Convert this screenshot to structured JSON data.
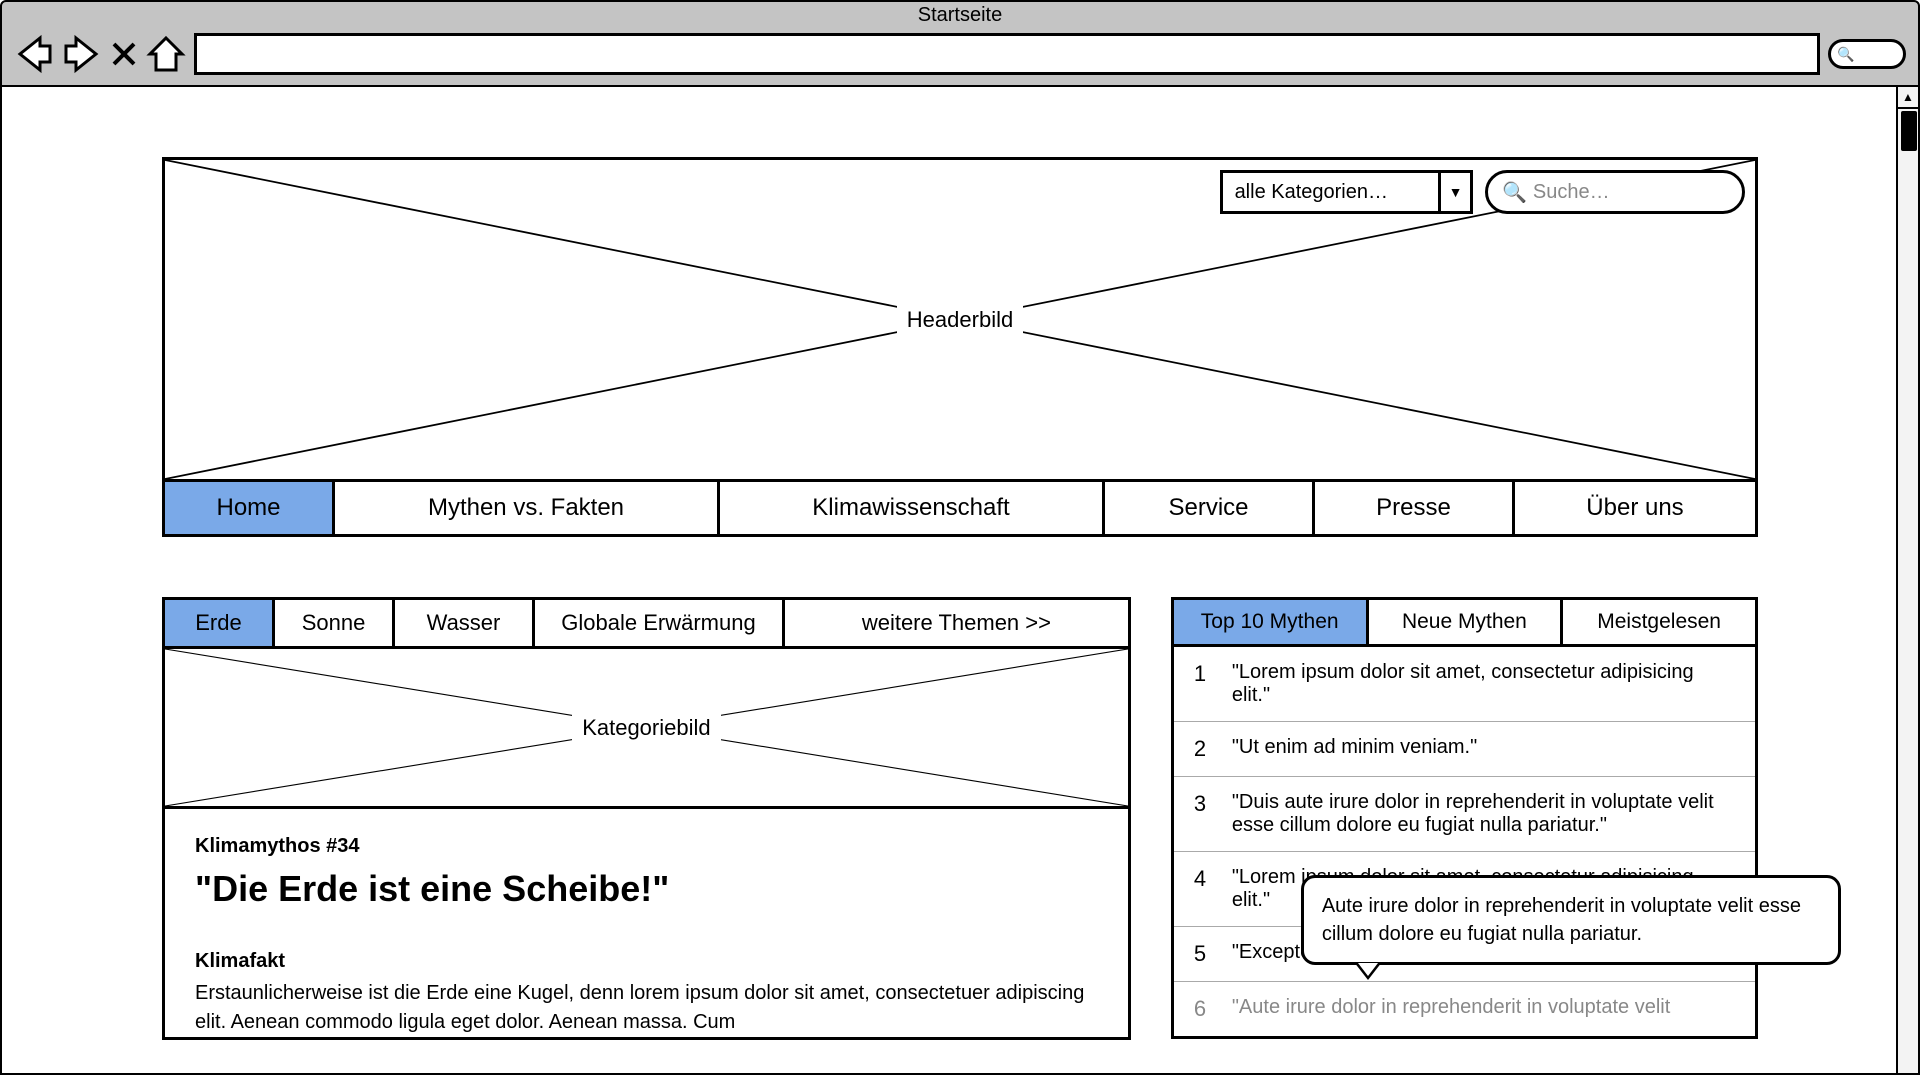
{
  "browser": {
    "title": "Startseite",
    "search_icon": "🔍"
  },
  "header": {
    "placeholder_label": "Headerbild",
    "category_select": "alle Kategorien…",
    "search_placeholder": "Suche…"
  },
  "main_nav": [
    "Home",
    "Mythen vs. Fakten",
    "Klimawissenschaft",
    "Service",
    "Presse",
    "Über uns"
  ],
  "topic_tabs": [
    "Erde",
    "Sonne",
    "Wasser",
    "Globale Erwärmung",
    "weitere Themen >>"
  ],
  "category_image_label": "Kategoriebild",
  "article": {
    "kicker": "Klimamythos #34",
    "title": "\"Die Erde ist eine Scheibe!\"",
    "section_title": "Klimafakt",
    "body": "Erstaunlicherweise ist die Erde eine Kugel, denn lorem ipsum dolor sit amet, consectetuer adipiscing elit. Aenean commodo ligula eget dolor. Aenean massa. Cum"
  },
  "sidebar_tabs": [
    "Top 10 Mythen",
    "Neue Mythen",
    "Meistgelesen"
  ],
  "myths": [
    {
      "n": "1",
      "t": "\"Lorem ipsum dolor sit amet, consectetur adipisicing elit.\""
    },
    {
      "n": "2",
      "t": "\"Ut enim ad minim veniam.\""
    },
    {
      "n": "3",
      "t": "\"Duis aute irure dolor in reprehenderit in voluptate velit esse cillum dolore eu fugiat nulla pariatur.\""
    },
    {
      "n": "4",
      "t": "\"Lorem ipsum dolor sit amet, consectetur adipisicing elit.\""
    },
    {
      "n": "5",
      "t": "\"Excepteur sint occaecat.\""
    },
    {
      "n": "6",
      "t": "\"Aute irure dolor in reprehenderit in voluptate velit"
    }
  ],
  "tooltip": "Aute irure dolor in reprehenderit in voluptate velit esse cillum dolore eu fugiat nulla pariatur."
}
